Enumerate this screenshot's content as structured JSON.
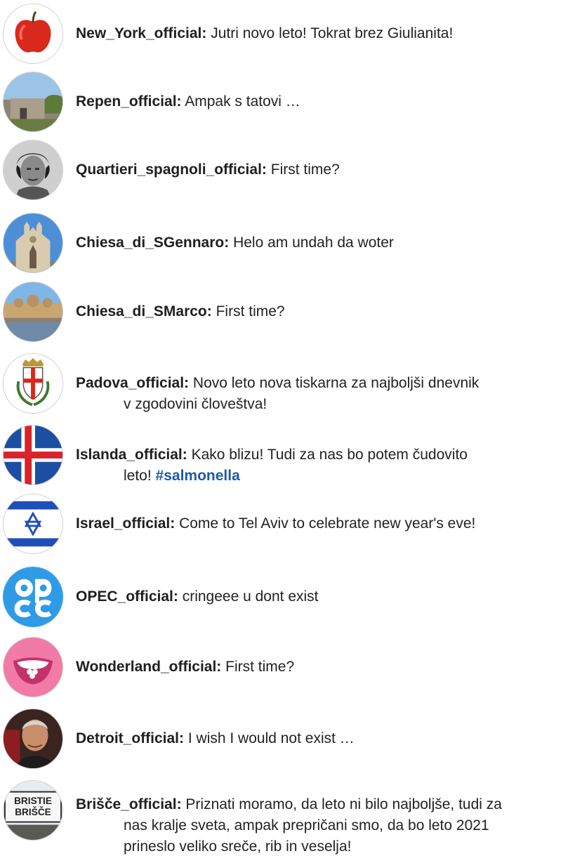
{
  "posts": [
    {
      "user": "New_York_official:",
      "message": "Jutri novo leto! Tokrat brez Giulianita!",
      "avatar_icon": "apple-avatar-icon"
    },
    {
      "user": "Repen_official:",
      "message": "Ampak s tatovi …",
      "avatar_icon": "stone-building-avatar-icon"
    },
    {
      "user": "Quartieri_spagnoli_official:",
      "message": "First time?",
      "avatar_icon": "portrait-avatar-icon"
    },
    {
      "user": "Chiesa_di_SGennaro:",
      "message": "Helo am undah da woter",
      "avatar_icon": "cathedral-avatar-icon"
    },
    {
      "user": "Chiesa_di_SMarco:",
      "message": "First time?",
      "avatar_icon": "basilica-avatar-icon"
    },
    {
      "user": "Padova_official:",
      "message_line1": "Novo leto nova tiskarna za najboljši dnevnik",
      "message_line2": "v zgodovini človeštva!",
      "avatar_icon": "coat-of-arms-avatar-icon"
    },
    {
      "user": "Islanda_official:",
      "message_line1": "Kako blizu! Tudi za nas bo potem čudovito",
      "message_line2": "leto!",
      "hashtag": "#salmonella",
      "avatar_icon": "iceland-flag-avatar-icon"
    },
    {
      "user": "Israel_official:",
      "message": "Come to Tel Aviv to celebrate new year's eve!",
      "avatar_icon": "israel-flag-avatar-icon"
    },
    {
      "user": "OPEC_official:",
      "message": "cringeee u dont exist",
      "avatar_icon": "opec-logo-avatar-icon"
    },
    {
      "user": "Wonderland_official:",
      "message": "First time?",
      "avatar_icon": "smiling-mouth-avatar-icon"
    },
    {
      "user": "Detroit_official:",
      "message": "I wish I would not exist …",
      "avatar_icon": "man-portrait-avatar-icon"
    },
    {
      "user": "Brišče_official:",
      "message_line1": "Priznati moramo, da leto ni bilo najboljše, tudi za",
      "message_line2": "nas kralje sveta, ampak prepričani smo, da bo leto 2021",
      "message_line3": "prineslo veliko sreče, rib in veselja!",
      "avatar_icon": "town-sign-avatar-icon",
      "sign_top": "BRISTIE",
      "sign_bottom": "BRIŠČE"
    }
  ],
  "colors": {
    "hashtag": "#1e5aa8",
    "text": "#222222"
  }
}
